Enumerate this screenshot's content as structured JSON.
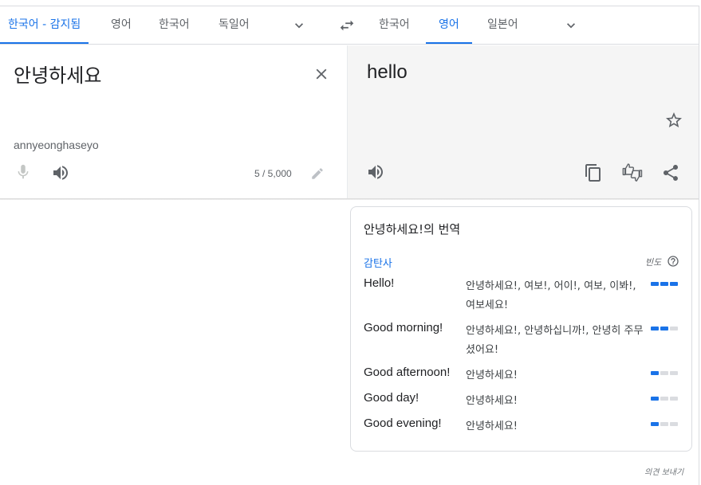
{
  "source_langs": [
    {
      "label": "한국어 - 감지됨",
      "active": true
    },
    {
      "label": "영어",
      "active": false
    },
    {
      "label": "한국어",
      "active": false
    },
    {
      "label": "독일어",
      "active": false
    }
  ],
  "target_langs": [
    {
      "label": "한국어",
      "active": false
    },
    {
      "label": "영어",
      "active": true
    },
    {
      "label": "일본어",
      "active": false
    }
  ],
  "icons": {
    "more_source": "chevron-down-icon",
    "swap": "swap-icon",
    "more_target": "chevron-down-icon",
    "clear": "close-icon",
    "mic": "mic-icon",
    "listen": "speaker-icon",
    "edit": "pencil-icon",
    "star": "star-icon",
    "copy": "copy-icon",
    "rate": "thumbs-icon",
    "share": "share-icon",
    "help": "help-icon"
  },
  "source": {
    "text": "안녕하세요",
    "transliteration": "annyeonghaseyo",
    "char_count": "5 / 5,000"
  },
  "target": {
    "text": "hello"
  },
  "dictionary": {
    "title": "안녕하세요!의 번역",
    "part_of_speech": "감탄사",
    "frequency_label": "빈도",
    "entries": [
      {
        "word": "Hello!",
        "synonyms": "안녕하세요!, 여보!, 어이!, 여보, 이봐!, 여보세요!",
        "frequency": 3
      },
      {
        "word": "Good morning!",
        "synonyms": "안녕하세요!, 안녕하십니까!, 안녕히 주무셨어요!",
        "frequency": 2
      },
      {
        "word": "Good afternoon!",
        "synonyms": "안녕하세요!",
        "frequency": 1
      },
      {
        "word": "Good day!",
        "synonyms": "안녕하세요!",
        "frequency": 1
      },
      {
        "word": "Good evening!",
        "synonyms": "안녕하세요!",
        "frequency": 1
      }
    ]
  },
  "feedback": "의견 보내기",
  "colors": {
    "accent": "#1a73e8",
    "text": "#202124",
    "muted": "#5f6368",
    "pane_bg": "#f5f5f5"
  }
}
